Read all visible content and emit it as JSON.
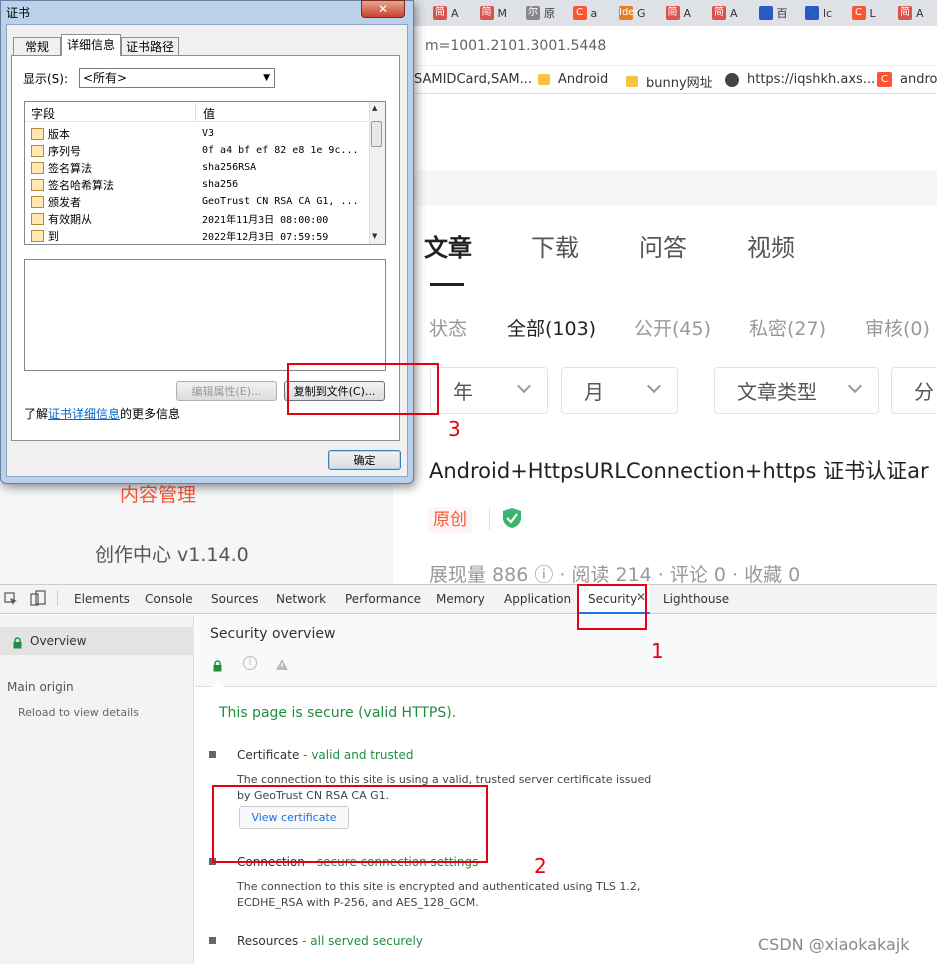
{
  "browser": {
    "tabs": [
      {
        "icon": "简",
        "label": "A",
        "color": "#d9534f"
      },
      {
        "icon": "简",
        "label": "M",
        "color": "#d9534f"
      },
      {
        "icon": "尔",
        "label": "原",
        "color": "#888"
      },
      {
        "icon": "C",
        "label": "a",
        "color": "#fc5531"
      },
      {
        "icon": "Ider",
        "label": "G",
        "color": "#e67e22"
      },
      {
        "icon": "简",
        "label": "A",
        "color": "#d9534f"
      },
      {
        "icon": "简",
        "label": "A",
        "color": "#d9534f"
      },
      {
        "icon": "🐾",
        "label": "百",
        "color": "#2d57c4"
      },
      {
        "icon": "🐾",
        "label": "lc",
        "color": "#2d57c4"
      },
      {
        "icon": "C",
        "label": "L",
        "color": "#fc5531"
      },
      {
        "icon": "简",
        "label": "A",
        "color": "#d9534f"
      }
    ],
    "url": "m=1001.2101.3001.5448",
    "bookmarks": [
      {
        "type": "text",
        "label": "SAMIDCard,SAM..."
      },
      {
        "type": "folder",
        "label": "Android"
      },
      {
        "type": "folder",
        "label": "bunny网址"
      },
      {
        "type": "globe",
        "label": "https://iqshkh.axs..."
      },
      {
        "type": "c",
        "label": "androi"
      }
    ]
  },
  "page": {
    "nav_tabs": [
      "文章",
      "下载",
      "问答",
      "视频"
    ],
    "filters": {
      "status": "状态",
      "all": "全部(103)",
      "public": "公开(45)",
      "private": "私密(27)",
      "review": "审核(0)"
    },
    "dropdowns": [
      "年",
      "月",
      "文章类型",
      "分"
    ],
    "article_title": "Android+HttpsURLConnection+https 证书认证ar",
    "original_badge": "原创",
    "stats": "展现量 886 ⓘ · 阅读 214 · 评论 0 · 收藏 0",
    "left_menu_item": "内容管理",
    "creator_center": "创作中心 v1.14.0"
  },
  "devtools": {
    "tabs": [
      "Elements",
      "Console",
      "Sources",
      "Network",
      "Performance",
      "Memory",
      "Application",
      "Security",
      "Lighthouse"
    ],
    "active_tab": "Security",
    "sidebar": {
      "overview": "Overview",
      "main_origin": "Main origin",
      "reload": "Reload to view details"
    },
    "security_title": "Security overview",
    "secure_msg": "This page is secure (valid HTTPS).",
    "cert_label": "Certificate",
    "cert_status": "- valid and trusted",
    "cert_desc1": "The connection to this site is using a valid, trusted server certificate issued",
    "cert_desc2": "by GeoTrust CN RSA CA G1.",
    "view_cert_button": "View certificate",
    "conn_label": "Connection",
    "conn_status": "- secure connection settings",
    "conn_desc1": "The connection to this site is encrypted and authenticated using TLS 1.2,",
    "conn_desc2": "ECDHE_RSA with P-256, and AES_128_GCM.",
    "res_label": "Resources",
    "res_status": "- all served securely"
  },
  "cert_dialog": {
    "title": "证书",
    "close": "✕",
    "tabs": [
      "常规",
      "详细信息",
      "证书路径"
    ],
    "active_tab": "详细信息",
    "show_label": "显示(S):",
    "show_value": "<所有>",
    "col_field": "字段",
    "col_value": "值",
    "rows": [
      {
        "field": "版本",
        "value": "V3"
      },
      {
        "field": "序列号",
        "value": "0f a4 bf ef 82 e8 1e 9c..."
      },
      {
        "field": "签名算法",
        "value": "sha256RSA"
      },
      {
        "field": "签名哈希算法",
        "value": "sha256"
      },
      {
        "field": "颁发者",
        "value": "GeoTrust CN RSA CA G1, ..."
      },
      {
        "field": "有效期从",
        "value": "2021年11月3日 08:00:00"
      },
      {
        "field": "到",
        "value": "2022年12月3日 07:59:59"
      }
    ],
    "edit_props_button": "编辑属性(E)...",
    "copy_file_button": "复制到文件(C)...",
    "learn_prefix": "了解",
    "learn_link": "证书详细信息",
    "learn_suffix": "的更多信息",
    "ok_button": "确定"
  },
  "annotations": {
    "n1": "1",
    "n2": "2",
    "n3": "3",
    "watermark": "CSDN @xiaokakajk"
  }
}
